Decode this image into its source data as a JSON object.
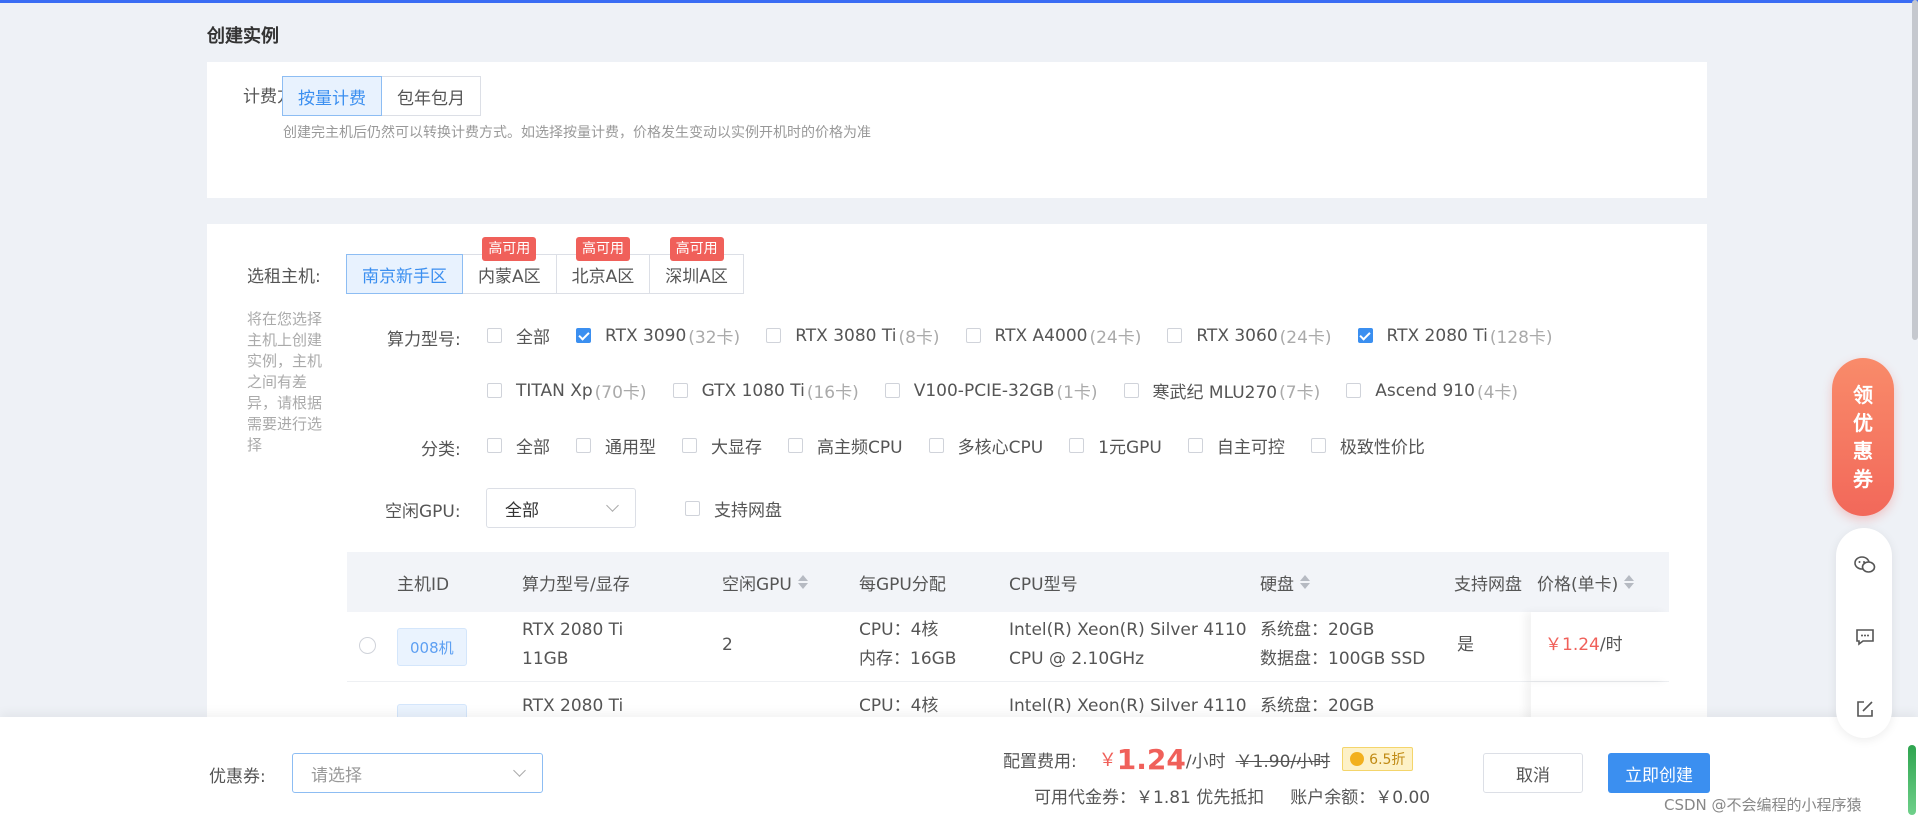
{
  "page_title": "创建实例",
  "billing": {
    "label": "计费方式:",
    "options": [
      "按量计费",
      "包年包月"
    ],
    "active": 0,
    "hint": "创建完主机后仍然可以转换计费方式。如选择按量计费，价格发生变动以实例开机时的价格为准"
  },
  "host": {
    "label": "选租主机:",
    "side_desc": "将在您选择主机上创建实例，主机之间有差异，请根据需要进行选择",
    "regions": [
      {
        "name": "南京新手区",
        "tag": ""
      },
      {
        "name": "内蒙A区",
        "tag": "高可用"
      },
      {
        "name": "北京A区",
        "tag": "高可用"
      },
      {
        "name": "深圳A区",
        "tag": "高可用"
      }
    ]
  },
  "gpu_model": {
    "label": "算力型号:",
    "row1": [
      {
        "name": "全部",
        "count": "",
        "checked": false
      },
      {
        "name": "RTX 3090",
        "count": "(32卡)",
        "checked": true
      },
      {
        "name": "RTX 3080 Ti",
        "count": "(8卡)",
        "checked": false
      },
      {
        "name": "RTX A4000",
        "count": "(24卡)",
        "checked": false
      },
      {
        "name": "RTX 3060",
        "count": "(24卡)",
        "checked": false
      },
      {
        "name": "RTX 2080 Ti",
        "count": "(128卡)",
        "checked": true
      }
    ],
    "row2": [
      {
        "name": "TITAN Xp",
        "count": "(70卡)",
        "checked": false
      },
      {
        "name": "GTX 1080 Ti",
        "count": "(16卡)",
        "checked": false
      },
      {
        "name": "V100-PCIE-32GB",
        "count": "(1卡)",
        "checked": false
      },
      {
        "name": "寒武纪 MLU270",
        "count": "(7卡)",
        "checked": false
      },
      {
        "name": "Ascend 910",
        "count": "(4卡)",
        "checked": false
      }
    ]
  },
  "category": {
    "label": "分类:",
    "options": [
      "全部",
      "通用型",
      "大显存",
      "高主频CPU",
      "多核心CPU",
      "1元GPU",
      "自主可控",
      "极致性价比"
    ]
  },
  "idle_gpu": {
    "label": "空闲GPU:",
    "value": "全部",
    "netdisk_label": "支持网盘"
  },
  "table": {
    "headers": [
      "主机ID",
      "算力型号/显存",
      "空闲GPU",
      "每GPU分配",
      "CPU型号",
      "硬盘",
      "支持网盘",
      "价格(单卡)"
    ],
    "rows": [
      {
        "id": "008机",
        "model": "RTX 2080 Ti",
        "vram": "11GB",
        "idle": "2",
        "cpu_alloc": "CPU：4核",
        "mem_alloc": "内存：16GB",
        "cpu_model": "Intel(R) Xeon(R) Silver 4110",
        "cpu_freq": "CPU @ 2.10GHz",
        "sys_disk": "系统盘：20GB",
        "data_disk": "数据盘：100GB SSD",
        "netdisk": "是",
        "price": "￥1.24",
        "unit": "/时"
      },
      {
        "id": "",
        "model": "RTX 2080 Ti",
        "vram": "",
        "idle": "",
        "cpu_alloc": "CPU：4核",
        "mem_alloc": "",
        "cpu_model": "Intel(R) Xeon(R) Silver 4110",
        "cpu_freq": "",
        "sys_disk": "系统盘：20GB",
        "data_disk": "",
        "netdisk": "",
        "price": "",
        "unit": ""
      }
    ]
  },
  "footer": {
    "coupon_label": "优惠券:",
    "coupon_placeholder": "请选择",
    "config_fee_label": "配置费用:",
    "currency": "￥",
    "price": "1.24",
    "per_hour": "/小时",
    "original_price": "￥1.90/小时",
    "discount": "6.5折",
    "voucher_text": "可用代金券：￥1.81 优先抵扣",
    "balance_text": "账户余额：￥0.00",
    "cancel": "取消",
    "create": "立即创建"
  },
  "float_coupon": [
    "领",
    "优",
    "惠",
    "券"
  ],
  "watermark": "CSDN @不会编程的小程序猿",
  "colors": {
    "accent": "#3b8ff0",
    "price": "#f0605a",
    "tag": "#f0605a"
  }
}
